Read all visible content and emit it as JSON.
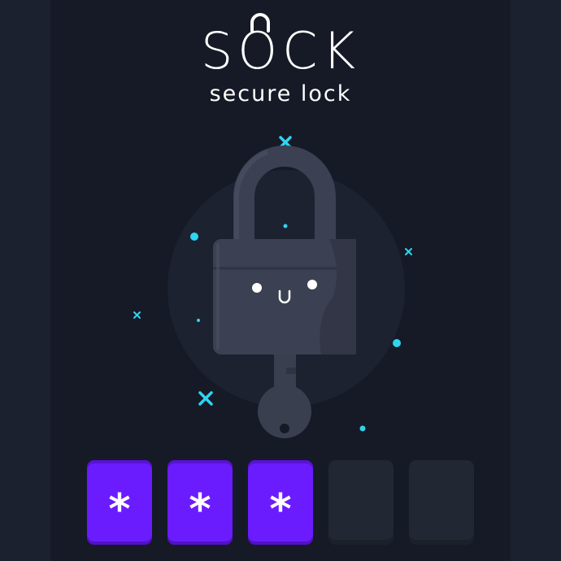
{
  "logo": {
    "word": "SOCK",
    "tagline": "secure lock"
  },
  "pin": {
    "boxes": [
      {
        "char": "*",
        "state": "filled"
      },
      {
        "char": "*",
        "state": "filled"
      },
      {
        "char": "*",
        "state": "filled"
      },
      {
        "char": "",
        "state": "empty"
      },
      {
        "char": "",
        "state": "empty"
      }
    ]
  },
  "colors": {
    "background": "#151a26",
    "accent": "#6a1cff",
    "sparkle": "#2fd4f0"
  },
  "icons": [
    "padlock-icon",
    "key-icon",
    "sparkle-icon"
  ]
}
